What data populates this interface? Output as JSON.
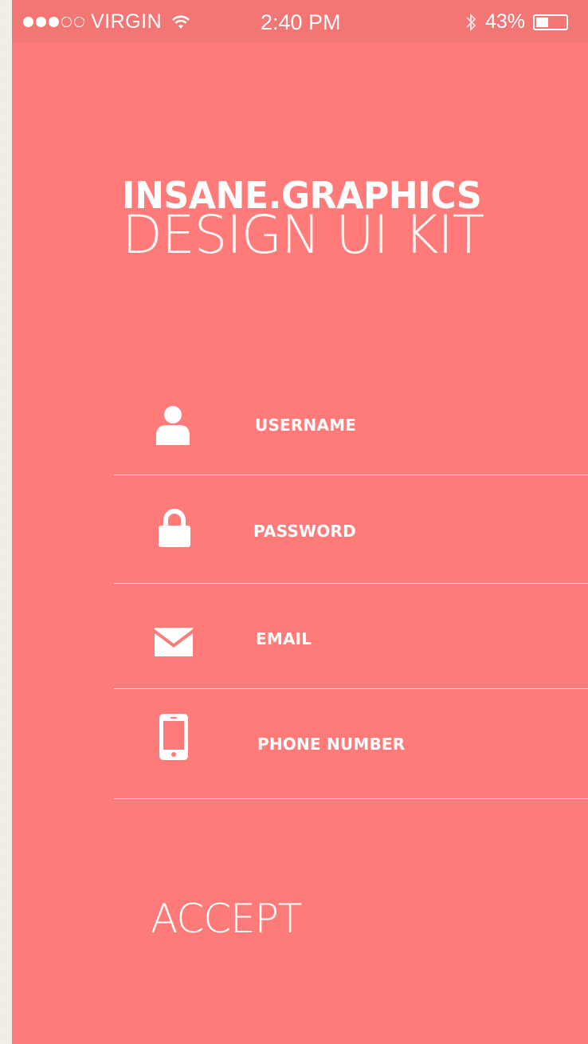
{
  "status_bar": {
    "carrier": "VIRGIN",
    "signal_bars_filled": 3,
    "signal_bars_total": 5,
    "time": "2:40 PM",
    "battery_percent": "43%",
    "battery_level": 0.43
  },
  "brand": {
    "title": "INSANE.GRAPHICS",
    "subtitle": "DESIGN UI KIT"
  },
  "form": {
    "fields": [
      {
        "label": "USERNAME",
        "icon": "user-icon"
      },
      {
        "label": "PASSWORD",
        "icon": "lock-icon"
      },
      {
        "label": "EMAIL",
        "icon": "envelope-icon"
      },
      {
        "label": "PHONE NUMBER",
        "icon": "phone-icon"
      }
    ],
    "accept_label": "ACCEPT"
  },
  "colors": {
    "background": "#ff7b79",
    "status_bar": "#f17674",
    "text": "#ffffff"
  }
}
